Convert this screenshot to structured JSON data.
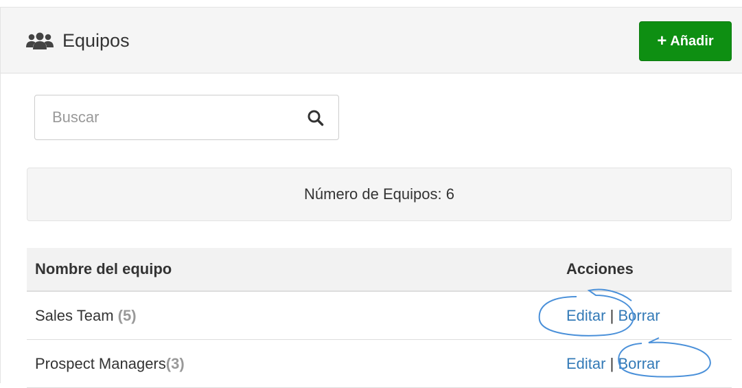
{
  "header": {
    "icon": "users-icon",
    "title": "Equipos",
    "add_button_label": "Añadir",
    "add_button_icon": "plus-icon"
  },
  "search": {
    "placeholder": "Buscar",
    "value": "",
    "icon": "search-icon"
  },
  "summary": {
    "count_text": "Número de Equipos: 6"
  },
  "table": {
    "columns": [
      "Nombre del equipo",
      "Acciones"
    ],
    "rows": [
      {
        "name": "Sales Team",
        "count": "(5)",
        "edit_label": "Editar",
        "separator": "|",
        "delete_label": "Borrar"
      },
      {
        "name": "Prospect Managers",
        "count": "(3)",
        "edit_label": "Editar",
        "separator": "|",
        "delete_label": "Borrar"
      }
    ]
  },
  "colors": {
    "add_button": "#0e8f12",
    "link": "#337ab7",
    "annotation_stroke": "#4a90d9"
  }
}
